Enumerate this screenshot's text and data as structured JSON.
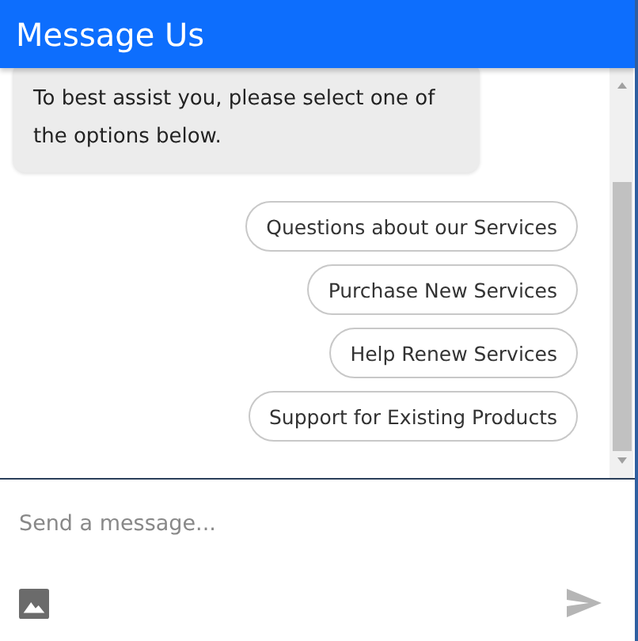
{
  "header": {
    "title": "Message Us"
  },
  "messages": [
    {
      "text": "To best assist you, please select one of the options below."
    }
  ],
  "options": [
    {
      "label": "Questions about our Services"
    },
    {
      "label": "Purchase New Services"
    },
    {
      "label": "Help Renew Services"
    },
    {
      "label": "Support for Existing Products"
    }
  ],
  "composer": {
    "placeholder": "Send a message..."
  }
}
